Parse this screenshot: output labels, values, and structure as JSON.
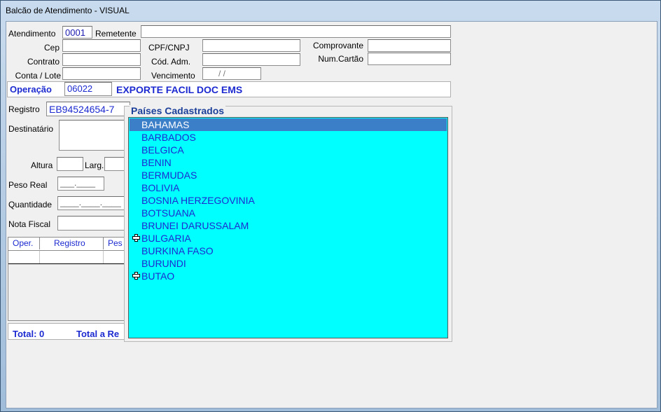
{
  "window": {
    "title": "Balcão de Atendimento - VISUAL"
  },
  "form": {
    "atendimento_label": "Atendimento",
    "atendimento_value": "0001",
    "remetente_label": "Remetente",
    "cep_label": "Cep",
    "cpf_label": "CPF/CNPJ",
    "comprovante_label": "Comprovante",
    "contrato_label": "Contrato",
    "cod_adm_label": "Cód. Adm.",
    "num_cartao_label": "Num.Cartão",
    "conta_lote_label": "Conta / Lote",
    "vencimento_label": "Vencimento",
    "vencimento_value": "/     /",
    "operacao_label": "Operação",
    "operacao_code": "06022",
    "operacao_desc": "EXPORTE FACIL DOC EMS",
    "registro_label": "Registro",
    "registro_value": "EB94524654-7",
    "destinatario_label": "Destinatário",
    "altura_label": "Altura",
    "larg_label": "Larg.",
    "peso_real_label": "Peso Real",
    "peso_real_value": "___.____",
    "quantidade_label": "Quantidade",
    "quantidade_value": "____.____.____",
    "nota_fiscal_label": "Nota Fiscal"
  },
  "grid": {
    "columns": [
      "Oper.",
      "Registro",
      "Pes"
    ]
  },
  "footer": {
    "total_label": "Total: 0",
    "total_receber_label": "Total a Re"
  },
  "popup": {
    "title": "Países Cadastrados",
    "countries": [
      "BAHAMAS",
      "BARBADOS",
      "BELGICA",
      "BENIN",
      "BERMUDAS",
      "BOLIVIA",
      "BOSNIA HERZEGOVINIA",
      "BOTSUANA",
      "BRUNEI DARUSSALAM",
      "BULGARIA",
      "BURKINA FASO",
      "BURUNDI",
      "BUTAO"
    ],
    "selected_index": 0,
    "list_color": "#00ffff",
    "selection_color": "#3c7fc9"
  }
}
